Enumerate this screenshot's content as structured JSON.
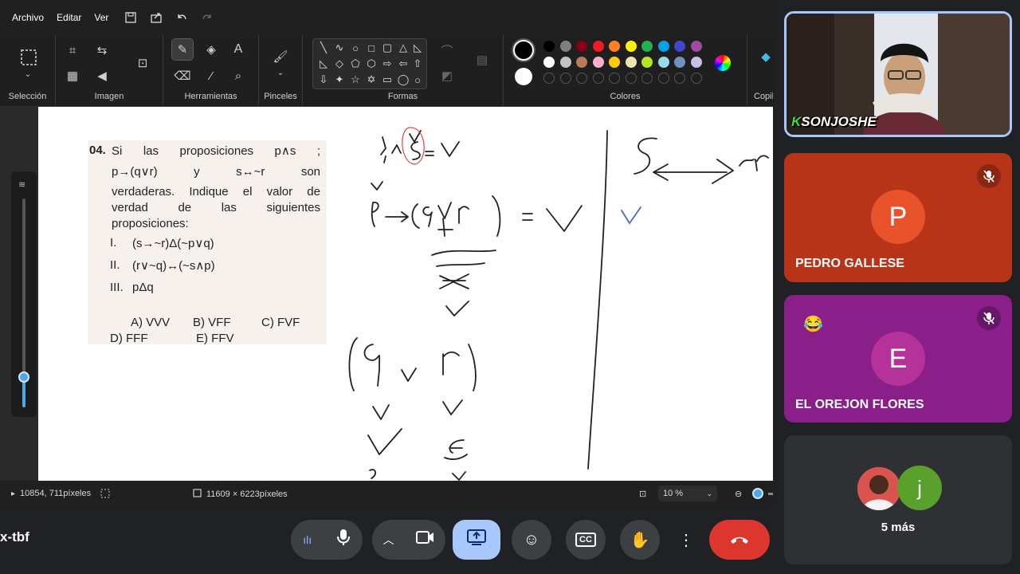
{
  "menu": {
    "file": "Archivo",
    "edit": "Editar",
    "view": "Ver"
  },
  "quick_access": [
    "save-icon",
    "share-icon",
    "undo-icon",
    "redo-icon"
  ],
  "ribbon": {
    "selection_label": "Selección",
    "image_label": "Imagen",
    "tools_label": "Herramientas",
    "brushes_label": "Pinceles",
    "shapes_label": "Formas",
    "colors_label": "Colores",
    "copilot_label": "Copil",
    "palette_row1": [
      "#000000",
      "#7f7f7f",
      "#880015",
      "#ed1c24",
      "#ff7f27",
      "#fff200",
      "#22b14c",
      "#00a2e8",
      "#3f48cc",
      "#a349a4"
    ],
    "palette_row2": [
      "#ffffff",
      "#c3c3c3",
      "#b97a57",
      "#ffaec9",
      "#ffc90e",
      "#efe4b0",
      "#b5e61d",
      "#99d9ea",
      "#7092be",
      "#c8bfe7"
    ]
  },
  "problem": {
    "number": "04.",
    "intro_line1": "Si las proposiciones p∧s ;",
    "intro_line2": "p→(q∨r) y s↔~r son",
    "intro_line3": "verdaderas. Indique el valor de",
    "intro_line4": "verdad de las siguientes",
    "intro_line5": "proposiciones:",
    "items": [
      {
        "num": "I.",
        "text": "(s→~r)Δ(~p∨q)"
      },
      {
        "num": "II.",
        "text": "(r∨~q)↔(~s∧p)"
      },
      {
        "num": "III.",
        "text": "pΔq"
      }
    ],
    "answers": {
      "a": "A) VVV",
      "b": "B) VFF",
      "c": "C) FVF",
      "d": "D) FFF",
      "e": "E) FFV"
    }
  },
  "status": {
    "cursor_pos": "10854, 711píxeles",
    "canvas_size": "11609 × 6223píxeles",
    "zoom": "10 %"
  },
  "meet": {
    "meeting_code": "x-tbf",
    "participants": [
      {
        "name": "",
        "overlay_text": "SONJOSHE",
        "kind": "video"
      },
      {
        "name": "PEDRO GALLESE",
        "initial": "P",
        "color": "#e8532b",
        "bg": "#b83418",
        "muted": true
      },
      {
        "name": "EL OREJON FLORES",
        "initial": "E",
        "color": "#b5329b",
        "bg": "#8a1f8a",
        "muted": true,
        "reaction": "😂"
      }
    ],
    "more_label": "5 más",
    "more_initial": "j",
    "more_color": "#5aa02c"
  }
}
